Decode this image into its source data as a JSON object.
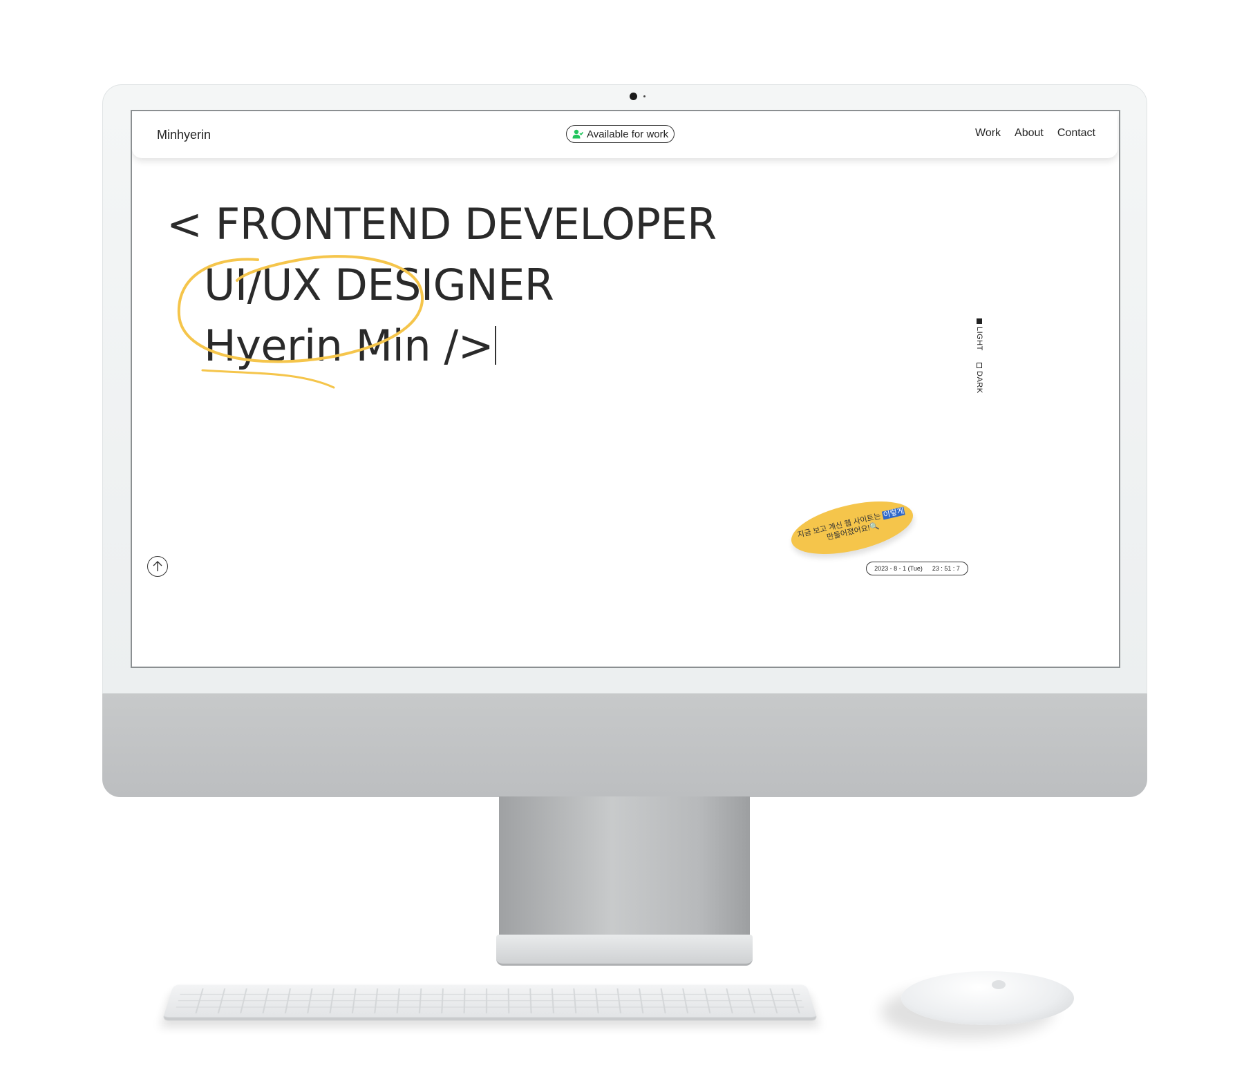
{
  "site": {
    "brand": "Minhyerin",
    "status": "Available for work",
    "nav": [
      "Work",
      "About",
      "Contact"
    ],
    "hero": {
      "line1": "< FRONTEND DEVELOPER",
      "line2": "UI/UX DESIGNER",
      "line3": "Hyerin Min />"
    },
    "theme": {
      "light": "LIGHT",
      "dark": "DARK",
      "selected": "LIGHT"
    },
    "sticker": {
      "text_part1": "지금 보고 계신 웹 사이트는",
      "highlight": "이렇게",
      "text_part2": "만들어졌어요!",
      "emoji": "🔍"
    },
    "clock": {
      "date": "2023 - 8 - 1 (Tue)",
      "time": "23 : 51 : 7"
    }
  },
  "colors": {
    "accent_yellow": "#f5c54b",
    "status_green": "#22c55e",
    "highlight_blue": "#2f68c9",
    "text_dark": "#2a2a2a"
  },
  "icons": {
    "status": "person-check-icon",
    "scroll_top": "arrow-up-icon"
  }
}
